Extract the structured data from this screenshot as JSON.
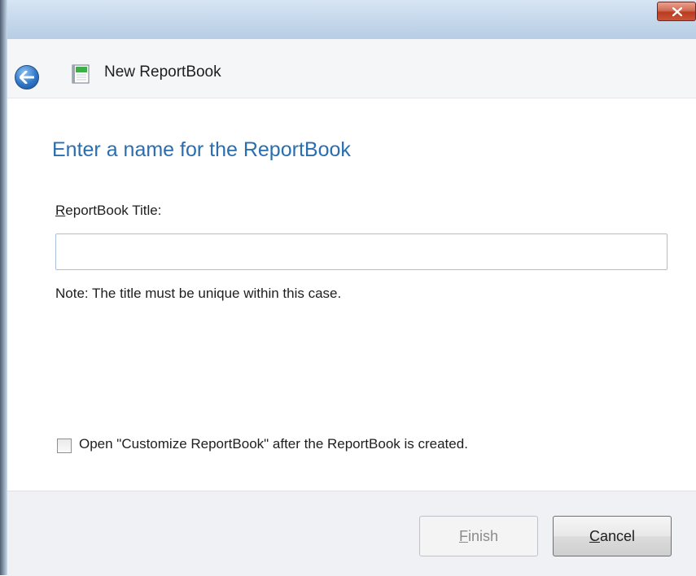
{
  "window": {
    "close_icon": "close-icon"
  },
  "nav": {
    "back_icon": "back-arrow-icon",
    "doc_icon": "reportbook-icon",
    "title": "New ReportBook"
  },
  "main": {
    "heading": "Enter a name for the ReportBook",
    "field_label_access": "R",
    "field_label_rest": "eportBook Title:",
    "title_value": "",
    "note": "Note:  The title must be unique within this case.",
    "checkbox_label": "Open \"Customize ReportBook\" after the ReportBook is created.",
    "checkbox_checked": false
  },
  "footer": {
    "finish_access": "F",
    "finish_rest": "inish",
    "finish_enabled": false,
    "cancel_access": "C",
    "cancel_rest": "ancel"
  },
  "colors": {
    "heading": "#2a6eb0",
    "close_button": "#c8553a",
    "disabled_text": "#8b8b8b"
  }
}
